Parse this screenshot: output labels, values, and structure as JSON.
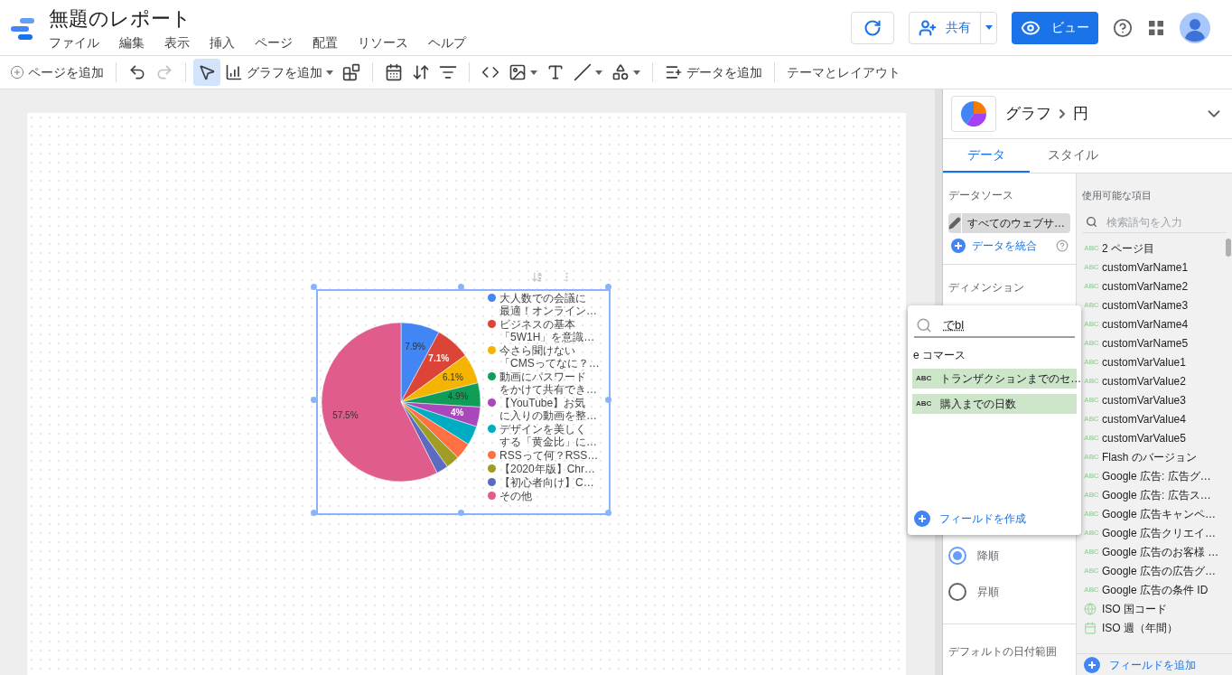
{
  "header": {
    "title": "無題のレポート",
    "menus": [
      "ファイル",
      "編集",
      "表示",
      "挿入",
      "ページ",
      "配置",
      "リソース",
      "ヘルプ"
    ],
    "share_label": "共有",
    "view_label": "ビュー"
  },
  "toolbar": [
    {
      "kind": "add-page",
      "label": "ページを追加"
    },
    {
      "kind": "divider"
    },
    {
      "kind": "undo",
      "disabled": false
    },
    {
      "kind": "redo",
      "disabled": true
    },
    {
      "kind": "divider"
    },
    {
      "kind": "select",
      "selected": true
    },
    {
      "kind": "add-chart",
      "label": "グラフを追加",
      "has_menu": true,
      "selected": false
    },
    {
      "kind": "community",
      "selected": false
    },
    {
      "kind": "divider"
    },
    {
      "kind": "date",
      "selected": false
    },
    {
      "kind": "data-control",
      "selected": false
    },
    {
      "kind": "filter",
      "selected": false
    },
    {
      "kind": "divider"
    },
    {
      "kind": "code",
      "selected": false
    },
    {
      "kind": "image",
      "has_menu": true,
      "selected": false
    },
    {
      "kind": "text",
      "selected": false
    },
    {
      "kind": "line",
      "has_menu": true,
      "selected": false
    },
    {
      "kind": "shape",
      "has_menu": true,
      "selected": false
    },
    {
      "kind": "divider"
    },
    {
      "kind": "add-data",
      "label": "データを追加"
    },
    {
      "kind": "divider"
    },
    {
      "kind": "theme",
      "label": "テーマとレイアウト"
    }
  ],
  "chart": {
    "legend": [
      {
        "lines": [
          "大人数での会議に",
          "最適！オンライン…"
        ]
      },
      {
        "lines": [
          "ビジネスの基本",
          "「5W1H」を意識…"
        ]
      },
      {
        "lines": [
          "今さら聞けない",
          "「CMSってなに？…"
        ]
      },
      {
        "lines": [
          "動画にパスワード",
          "をかけて共有でき…"
        ]
      },
      {
        "lines": [
          "【YouTube】お気",
          "に入りの動画を整…"
        ]
      },
      {
        "lines": [
          "デザインを美しく",
          "する「黄金比」に…"
        ]
      },
      {
        "lines": [
          "RSSって何？RSS…"
        ]
      },
      {
        "lines": [
          "【2020年版】Chr…"
        ]
      },
      {
        "lines": [
          "【初心者向け】C…"
        ]
      },
      {
        "lines": [
          "その他"
        ]
      }
    ],
    "chart_data": {
      "type": "pie",
      "values": [
        7.9,
        7.1,
        6.1,
        4.9,
        4,
        3.9,
        3.4,
        2.8,
        2.4,
        57.5
      ],
      "colors": [
        "#4285f4",
        "#db4437",
        "#f4b400",
        "#0f9d58",
        "#ab47bc",
        "#00acc1",
        "#ff7043",
        "#9e9d24",
        "#5c6bc0",
        "#e05c8c"
      ],
      "value_labels": [
        "7.9%",
        "7.1%",
        "6.1%",
        "4.9%",
        "4%",
        null,
        null,
        null,
        null,
        "57.5%"
      ]
    }
  },
  "panel": {
    "chart_category": "グラフ",
    "chart_type": "円",
    "tabs": [
      {
        "label": "データ",
        "selected": true
      },
      {
        "label": "スタイル",
        "selected": false
      }
    ],
    "data_source_heading": "データソース",
    "data_source": "すべてのウェブサ…",
    "blend_label": "データを統合",
    "dimension_heading": "ディメンション",
    "sort_options": [
      {
        "label": "降順",
        "selected": true
      },
      {
        "label": "昇順",
        "selected": false
      }
    ],
    "date_range_heading": "デフォルトの日付範囲"
  },
  "fields": {
    "heading": "使用可能な項目",
    "search_placeholder": "検索語句を入力",
    "items": [
      {
        "kind": "text",
        "badge": "ABC",
        "name": "2 ページ目"
      },
      {
        "kind": "text",
        "badge": "ABC",
        "name": "customVarName1"
      },
      {
        "kind": "text",
        "badge": "ABC",
        "name": "customVarName2"
      },
      {
        "kind": "text",
        "badge": "ABC",
        "name": "customVarName3"
      },
      {
        "kind": "text",
        "badge": "ABC",
        "name": "customVarName4"
      },
      {
        "kind": "text",
        "badge": "ABC",
        "name": "customVarName5"
      },
      {
        "kind": "text",
        "badge": "ABC",
        "name": "customVarValue1"
      },
      {
        "kind": "text",
        "badge": "ABC",
        "name": "customVarValue2"
      },
      {
        "kind": "text",
        "badge": "ABC",
        "name": "customVarValue3"
      },
      {
        "kind": "text",
        "badge": "ABC",
        "name": "customVarValue4"
      },
      {
        "kind": "text",
        "badge": "ABC",
        "name": "customVarValue5"
      },
      {
        "kind": "text",
        "badge": "ABC",
        "name": "Flash のバージョン"
      },
      {
        "kind": "text",
        "badge": "ABC",
        "name": "Google 広告: 広告グ…"
      },
      {
        "kind": "text",
        "badge": "ABC",
        "name": "Google 広告: 広告ス…"
      },
      {
        "kind": "text",
        "badge": "ABC",
        "name": "Google 広告キャンペ…"
      },
      {
        "kind": "text",
        "badge": "ABC",
        "name": "Google 広告クリエイ…"
      },
      {
        "kind": "text",
        "badge": "ABC",
        "name": "Google 広告のお客様 …"
      },
      {
        "kind": "text",
        "badge": "ABC",
        "name": "Google 広告の広告グ…"
      },
      {
        "kind": "text",
        "badge": "ABC",
        "name": "Google 広告の条件 ID"
      },
      {
        "kind": "geo",
        "name": "ISO 国コード"
      },
      {
        "kind": "date",
        "name": "ISO 週（年間）"
      }
    ],
    "add_label": "フィールドを追加"
  },
  "field_picker": {
    "query": "でbl",
    "group": "e コマース",
    "items": [
      {
        "badge": "ABC",
        "name": "トランザクションまでのセ…"
      },
      {
        "badge": "ABC",
        "name": "購入までの日数"
      }
    ],
    "create_label": "フィールドを作成"
  }
}
